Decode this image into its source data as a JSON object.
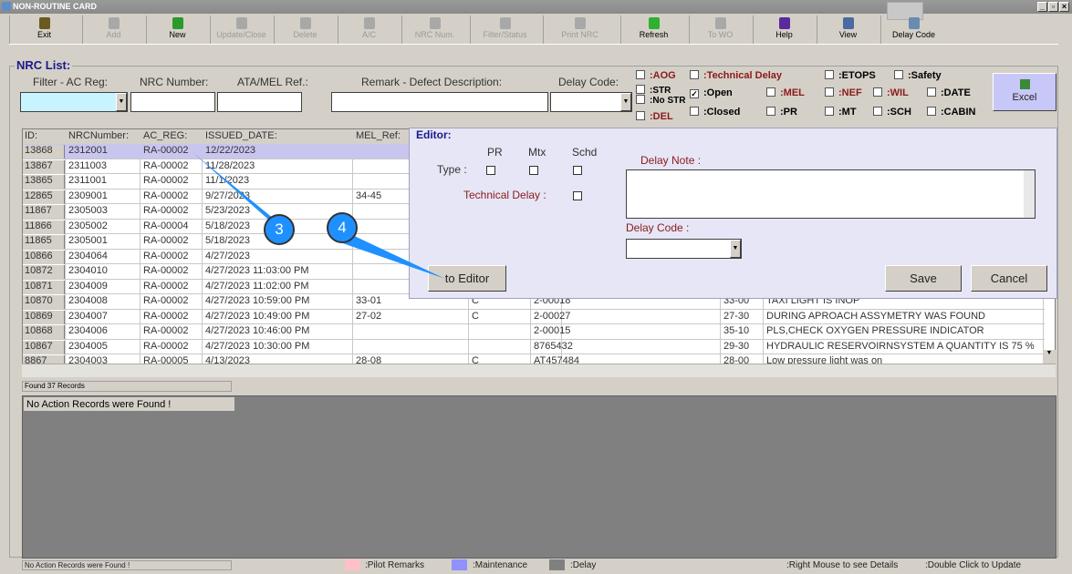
{
  "window": {
    "title": "NON-ROUTINE CARD",
    "min": "_",
    "restore": "▫",
    "close": "×"
  },
  "toolbar": [
    {
      "label": "Exit",
      "enabled": true,
      "color": "#6a5a20"
    },
    {
      "label": "Add",
      "enabled": false
    },
    {
      "label": "New",
      "enabled": true,
      "color": "#2a9a2a"
    },
    {
      "label": "Update/Close",
      "enabled": false
    },
    {
      "label": "Delete",
      "enabled": false
    },
    {
      "label": "A/C",
      "enabled": false
    },
    {
      "label": "NRC Num.",
      "enabled": false
    },
    {
      "label": "Filter/Status",
      "enabled": false
    },
    {
      "label": "Print NRC",
      "enabled": false
    },
    {
      "label": "Refresh",
      "enabled": true,
      "color": "#30b030"
    },
    {
      "label": "To WO",
      "enabled": false
    },
    {
      "label": "Help",
      "enabled": true,
      "color": "#5a2a9a"
    },
    {
      "label": "View",
      "enabled": true,
      "color": "#4a6aa0"
    },
    {
      "label": "Delay Code",
      "enabled": true,
      "color": "#6a8ab0"
    }
  ],
  "nrc_list": {
    "title": "NRC List:",
    "filters": {
      "ac_reg": "Filter - AC Reg:",
      "nrc_number": "NRC Number:",
      "ata_mel": "ATA/MEL Ref.:",
      "remark": "Remark - Defect Description:",
      "delay_code": "Delay Code:"
    },
    "checkboxes": [
      {
        "label": ":AOG",
        "checked": false,
        "red": true
      },
      {
        "label": ":STR",
        "checked": false,
        "red": false
      },
      {
        "label": ":No STR",
        "checked": false,
        "red": false
      },
      {
        "label": ":DEL",
        "checked": false,
        "red": true
      },
      {
        "label": ":Technical Delay",
        "checked": false,
        "red": true
      },
      {
        "label": ":Open",
        "checked": true,
        "red": false
      },
      {
        "label": ":Closed",
        "checked": false,
        "red": false
      },
      {
        "label": ":MEL",
        "checked": false,
        "red": true
      },
      {
        "label": ":PR",
        "checked": false,
        "red": false
      },
      {
        "label": ":ETOPS",
        "checked": false,
        "red": false
      },
      {
        "label": ":NEF",
        "checked": false,
        "red": true
      },
      {
        "label": ":MT",
        "checked": false,
        "red": false
      },
      {
        "label": ":Safety",
        "checked": false,
        "red": false
      },
      {
        "label": ":WIL",
        "checked": false,
        "red": true
      },
      {
        "label": ":SCH",
        "checked": false,
        "red": false
      },
      {
        "label": ":DATE",
        "checked": false,
        "red": false
      },
      {
        "label": ":CABIN",
        "checked": false,
        "red": false
      }
    ],
    "excel": "Excel"
  },
  "grid": {
    "headers": [
      "ID:",
      "NRCNumber:",
      "AC_REG:",
      "ISSUED_DATE:",
      "MEL_Ref:"
    ],
    "rows": [
      [
        "13868",
        "2312001",
        "RA-00002",
        "12/22/2023",
        "",
        "",
        "",
        "",
        ""
      ],
      [
        "13867",
        "2311003",
        "RA-00002",
        "11/28/2023",
        "",
        "",
        "",
        "",
        ""
      ],
      [
        "13865",
        "2311001",
        "RA-00002",
        "11/1/2023",
        "",
        "",
        "",
        "",
        ""
      ],
      [
        "12865",
        "2309001",
        "RA-00002",
        "9/27/2023",
        "34-45",
        "",
        "",
        "",
        ""
      ],
      [
        "11867",
        "2305003",
        "RA-00002",
        "5/23/2023",
        "",
        "",
        "",
        "",
        ""
      ],
      [
        "11866",
        "2305002",
        "RA-00004",
        "5/18/2023",
        "",
        "",
        "",
        "",
        ""
      ],
      [
        "11865",
        "2305001",
        "RA-00002",
        "5/18/2023",
        "",
        "",
        "",
        "",
        ""
      ],
      [
        "10866",
        "2304064",
        "RA-00002",
        "4/27/2023",
        "",
        "",
        "",
        "",
        ""
      ],
      [
        "10872",
        "2304010",
        "RA-00002",
        "4/27/2023 11:03:00 PM",
        "",
        "",
        "",
        "",
        ""
      ],
      [
        "10871",
        "2304009",
        "RA-00002",
        "4/27/2023 11:02:00 PM",
        "",
        "",
        "",
        "",
        ""
      ],
      [
        "10870",
        "2304008",
        "RA-00002",
        "4/27/2023 10:59:00 PM",
        "33-01",
        "C",
        "2-00018",
        "33-00",
        "TAXI LIGHT IS INOP"
      ],
      [
        "10869",
        "2304007",
        "RA-00002",
        "4/27/2023 10:49:00 PM",
        "27-02",
        "C",
        "2-00027",
        "27-30",
        "DURING APROACH ASSYMETRY WAS FOUND"
      ],
      [
        "10868",
        "2304006",
        "RA-00002",
        "4/27/2023 10:46:00 PM",
        "",
        "",
        "2-00015",
        "35-10",
        "PLS,CHECK OXYGEN PRESSURE INDICATOR"
      ],
      [
        "10867",
        "2304005",
        "RA-00002",
        "4/27/2023 10:30:00 PM",
        "",
        "",
        "8765432",
        "29-30",
        "HYDRAULIC RESERVOIRNSYSTEM A QUANTITY IS 75 %"
      ],
      [
        "8867",
        "2304003",
        "RA-00005",
        "4/13/2023",
        "28-08",
        "C",
        "AT457484",
        "28-00",
        "Low pressure light was on"
      ]
    ],
    "found": "Found 37 Records"
  },
  "editor": {
    "title": "Editor:",
    "type": "Type :",
    "pr": "PR",
    "mtx": "Mtx",
    "schd": "Schd",
    "technical_delay": "Technical Delay :",
    "delay_note": "Delay Note :",
    "delay_code": "Delay Code :",
    "to_editor": "to Editor",
    "save": "Save",
    "cancel": "Cancel"
  },
  "callouts": [
    "3",
    "4"
  ],
  "actions": {
    "message": "No Action Records were Found !"
  },
  "statusbar": {
    "left": "No Action Records were Found !",
    "legend": [
      {
        "label": ":Pilot Remarks",
        "color": "#ffc0c8"
      },
      {
        "label": ":Maintenance",
        "color": "#9090ff"
      },
      {
        "label": ":Delay",
        "color": "#808080"
      }
    ],
    "hint1": ":Right Mouse to see Details",
    "hint2": ":Double Click to Update"
  }
}
